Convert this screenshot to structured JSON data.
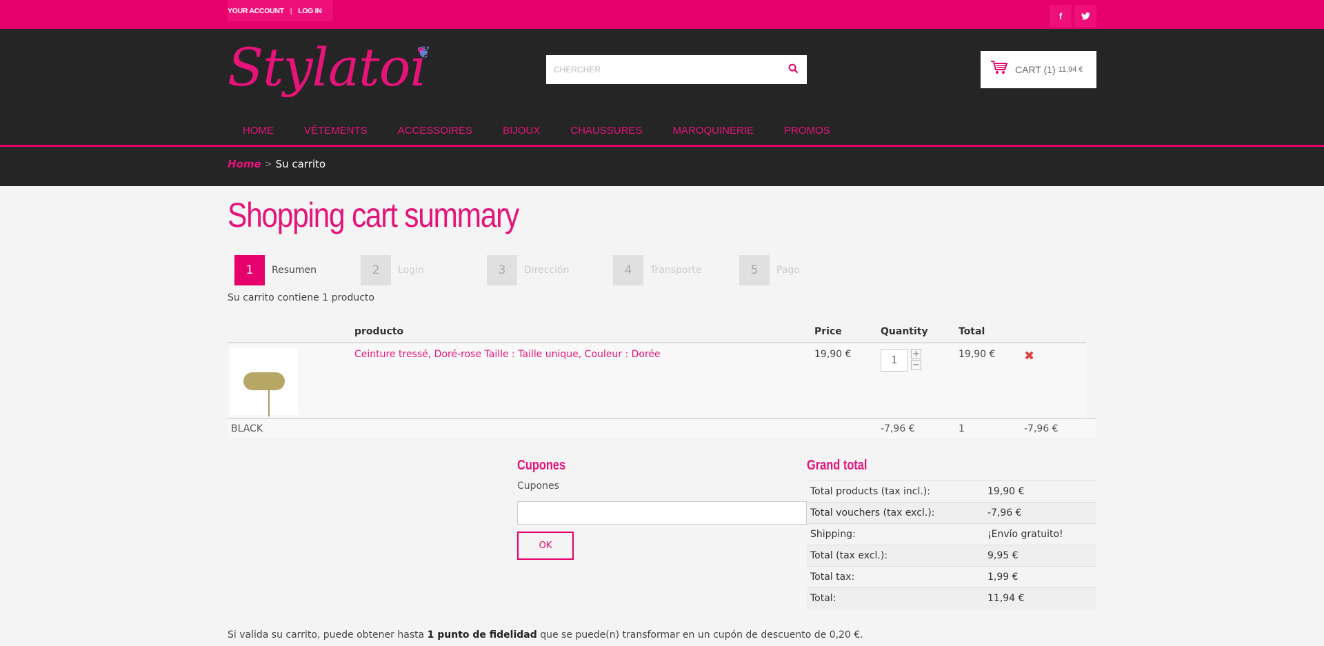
{
  "topbar": {
    "account": "YOUR ACCOUNT",
    "separator": "|",
    "login": "LOG IN",
    "social": [
      "f",
      "t"
    ]
  },
  "header": {
    "logo": "Stylatoi",
    "search_placeholder": "CHERCHER",
    "cart_label": "CART (1)",
    "cart_amount": "11,94 €",
    "nav": [
      "HOME",
      "VÊTEMENTS",
      "ACCESSOIRES",
      "BIJOUX",
      "CHAUSSURES",
      "MAROQUINERIE",
      "PROMOS"
    ]
  },
  "breadcrumb": {
    "home": "Home",
    "current": "Su carrito"
  },
  "page_title": "Shopping cart summary",
  "steps": [
    {
      "num": "1",
      "label": "Resumen"
    },
    {
      "num": "2",
      "label": "Login"
    },
    {
      "num": "3",
      "label": "Dirección"
    },
    {
      "num": "4",
      "label": "Transporte"
    },
    {
      "num": "5",
      "label": "Pago"
    }
  ],
  "cart_count": "Su carrito contiene 1 producto",
  "table": {
    "headers": {
      "product": "producto",
      "price": "Price",
      "quantity": "Quantity",
      "total": "Total"
    },
    "item": {
      "name": "Ceinture tressé, Doré-rose Taille : Taille unique, Couleur : Dorée",
      "price": "19,90 €",
      "quantity": "1",
      "total": "19,90 €"
    },
    "voucher": {
      "name": "BLACK",
      "value": "-7,96 €",
      "quantity": "1",
      "total": "-7,96 €"
    }
  },
  "coupon": {
    "title": "Cupones",
    "label": "Cupones",
    "button": "OK"
  },
  "grand_total": {
    "title": "Grand total",
    "rows": [
      {
        "label": "Total products (tax incl.):",
        "value": "19,90 €"
      },
      {
        "label": "Total vouchers (tax excl.):",
        "value": "-7,96 €"
      },
      {
        "label": "Shipping:",
        "value": "¡Envío gratuito!"
      },
      {
        "label": "Total (tax excl.):",
        "value": "9,95 €"
      },
      {
        "label": "Total tax:",
        "value": "1,99 €"
      },
      {
        "label": "Total:",
        "value": "11,94 €"
      }
    ]
  },
  "loyalty": {
    "prefix": "Si valida su carrito, puede obtener hasta ",
    "bold": "1 punto de fidelidad",
    "suffix": " que se puede(n) transformar en un cupón de descuento de 0,20 €."
  },
  "colors": {
    "accent": "#e5006b",
    "header_bg": "#252525",
    "page_bg": "#f4f4f4"
  }
}
